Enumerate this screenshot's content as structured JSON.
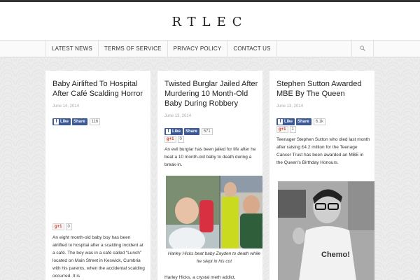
{
  "site": {
    "logo": "RTLEC"
  },
  "nav": {
    "items": [
      "LATEST NEWS",
      "TERMS OF SERVICE",
      "PRIVACY POLICY",
      "CONTACT US"
    ]
  },
  "posts": [
    {
      "title": "Baby Airlifted To Hospital After Café Scalding Horror",
      "date": "June 14, 2014",
      "fb_like": "Like",
      "fb_share": "Share",
      "fb_count": "116",
      "gp_label": "+1",
      "gp_count": "0",
      "excerpt": "An eight month-old baby boy has been airlifted to hospital after a scalding incident at a café. The boy was in a café called “Lunch” located on Main Street in Keswick, Cumbria with his parents, when the accidental scalding occurred.  It is"
    },
    {
      "title": "Twisted Burglar Jailed After Murdering 10 Month-Old Baby During Robbery",
      "date": "June 13, 2014",
      "fb_like": "Like",
      "fb_share": "Share",
      "fb_count": "571",
      "gp_label": "+1",
      "gp_count": "0",
      "excerpt": "An evil burglar has been jailed for life after he beat a 10 month-old baby to death during a break-in.",
      "caption": "Harley Hicks beat baby Zayden to death while he slept in his cot",
      "excerpt2": "Harley Hicks, a crystal meth addict,"
    },
    {
      "title": "Stephen Sutton Awarded MBE By The Queen",
      "date": "June 13, 2014",
      "fb_like": "Like",
      "fb_share": "Share",
      "fb_count": "6.1k",
      "gp_label": "+1",
      "gp_count": "1",
      "excerpt": "Teenager Stephen Sutton who died last month after raising £4.2 million for the Teenage Cancer Trust has been awarded an MBE in the Queen's Birthday Honours.",
      "shirt_text": "Chemo!"
    }
  ],
  "icons": {
    "search": "search-icon",
    "facebook": "facebook-icon",
    "googleplus": "google-plus-icon"
  },
  "colors": {
    "facebook": "#3b5998",
    "googleplus": "#d23a22",
    "topbar": "#333333"
  }
}
